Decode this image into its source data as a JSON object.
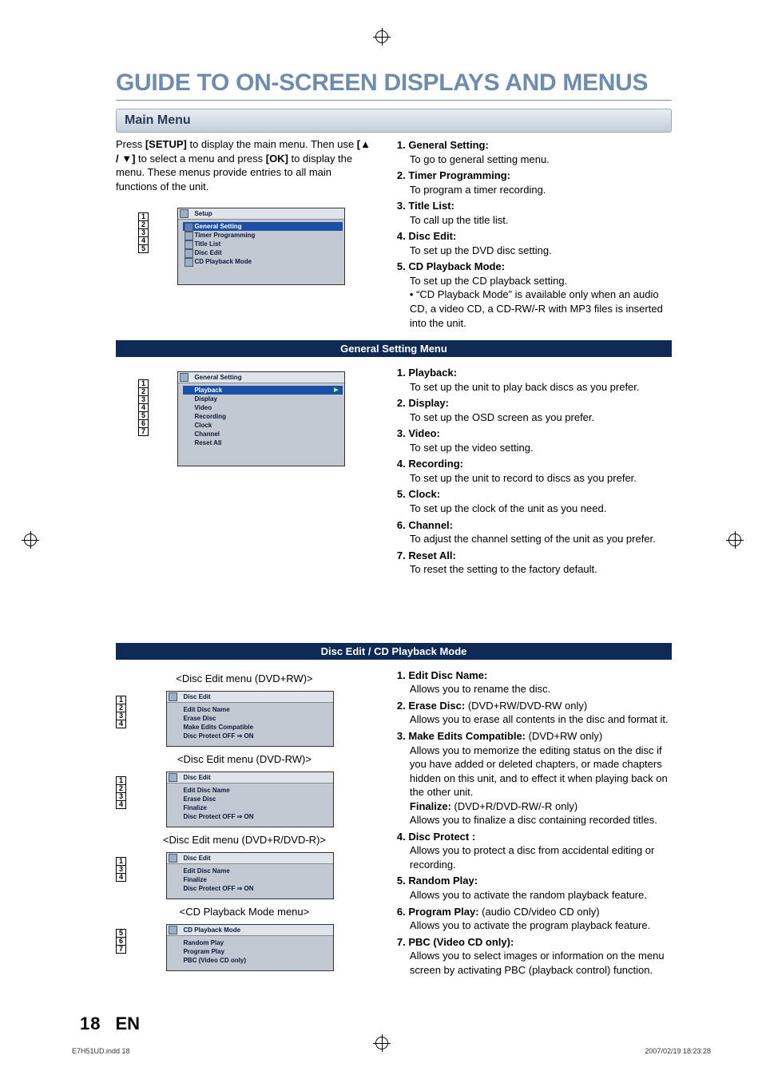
{
  "page_title": "GUIDE TO ON-SCREEN DISPLAYS AND MENUS",
  "section_main_menu": "Main Menu",
  "intro": {
    "t1": "Press ",
    "setup": "[SETUP]",
    "t2": " to display the main menu. Then use ",
    "arrows": "[▲ / ▼]",
    "t3": " to select a menu and press ",
    "ok": "[OK]",
    "t4": " to display the menu. These menus provide entries to all main functions of the unit."
  },
  "setup_menu": {
    "title": "Setup",
    "items": [
      "General Setting",
      "Timer Programming",
      "Title List",
      "Disc Edit",
      "CD Playback Mode"
    ]
  },
  "main_list": [
    {
      "n": "1.",
      "lbl": "General Setting:",
      "desc": "To go to general setting menu."
    },
    {
      "n": "2.",
      "lbl": "Timer Programming:",
      "desc": "To program a timer recording."
    },
    {
      "n": "3.",
      "lbl": "Title List:",
      "desc": "To call up the title list."
    },
    {
      "n": "4.",
      "lbl": "Disc Edit:",
      "desc": "To set up the DVD disc setting."
    },
    {
      "n": "5.",
      "lbl": "CD Playback Mode:",
      "desc": "To set up the CD playback setting.",
      "bullet": "• “CD Playback Mode” is available only when an audio CD, a video CD, a CD-RW/-R with MP3 files is inserted into the unit."
    }
  ],
  "divider_general": "General Setting Menu",
  "general_menu": {
    "title": "General Setting",
    "items": [
      "Playback",
      "Display",
      "Video",
      "Recording",
      "Clock",
      "Channel",
      "Reset All"
    ]
  },
  "general_list": [
    {
      "n": "1.",
      "lbl": "Playback:",
      "desc": "To set up the unit to play back discs as you prefer."
    },
    {
      "n": "2.",
      "lbl": "Display:",
      "desc": "To set up the OSD screen as you prefer."
    },
    {
      "n": "3.",
      "lbl": "Video:",
      "desc": "To set up the video setting."
    },
    {
      "n": "4.",
      "lbl": "Recording:",
      "desc": "To set up the unit to record to discs as you prefer."
    },
    {
      "n": "5.",
      "lbl": "Clock:",
      "desc": "To set up the clock of the unit as you need."
    },
    {
      "n": "6.",
      "lbl": "Channel:",
      "desc": "To adjust the channel setting of the unit as you prefer."
    },
    {
      "n": "7.",
      "lbl": "Reset All:",
      "desc": "To reset the setting to the factory default."
    }
  ],
  "divider_disc": "Disc Edit / CD Playback Mode",
  "disc_menus": {
    "a_caption": "<Disc Edit menu (DVD+RW)>",
    "a_title": "Disc Edit",
    "a_items": [
      "Edit Disc Name",
      "Erase Disc",
      "Make Edits Compatible",
      "Disc Protect OFF ⇒ ON"
    ],
    "b_caption": "<Disc Edit menu (DVD-RW)>",
    "b_title": "Disc Edit",
    "b_items": [
      "Edit Disc Name",
      "Erase Disc",
      "Finalize",
      "Disc Protect OFF ⇒ ON"
    ],
    "c_caption": "<Disc Edit menu (DVD+R/DVD-R)>",
    "c_title": "Disc Edit",
    "c_items": [
      "Edit Disc Name",
      "Finalize",
      "Disc Protect OFF ⇒ ON"
    ],
    "d_caption": "<CD Playback Mode menu>",
    "d_title": "CD Playback Mode",
    "d_items": [
      "Random Play",
      "Program Play",
      "PBC (Video CD only)"
    ]
  },
  "disc_list": [
    {
      "n": "1.",
      "lbl": "Edit Disc Name:",
      "desc": "Allows you to rename the disc."
    },
    {
      "n": "2.",
      "lbl": "Erase Disc:",
      "ext": " (DVD+RW/DVD-RW only)",
      "desc": "Allows you to erase all contents in the disc and format it."
    },
    {
      "n": "3.",
      "lbl": "Make Edits Compatible:",
      "ext": " (DVD+RW only)",
      "desc": "Allows you to memorize the editing status on the disc if you have added or deleted chapters, or made chapters hidden on this unit, and to effect it when playing back on the other unit.",
      "extra_lbl": "Finalize:",
      "extra_ext": " (DVD+R/DVD-RW/-R only)",
      "extra_desc": "Allows you to finalize a disc containing recorded titles."
    },
    {
      "n": "4.",
      "lbl": "Disc Protect :",
      "desc": "Allows you to protect a disc from accidental editing or recording."
    },
    {
      "n": "5.",
      "lbl": "Random Play:",
      "desc": "Allows you to activate the random playback feature."
    },
    {
      "n": "6.",
      "lbl": "Program Play:",
      "ext": " (audio CD/video CD only)",
      "desc": "Allows you to activate the program playback feature."
    },
    {
      "n": "7.",
      "lbl": "PBC (Video CD only):",
      "desc": "Allows you to select images or information on the menu screen by activating PBC (playback control) function."
    }
  ],
  "footer": {
    "page": "18",
    "lang": "EN",
    "file": "E7H51UD.indd   18",
    "ts": "2007/02/19   18:23:28"
  }
}
